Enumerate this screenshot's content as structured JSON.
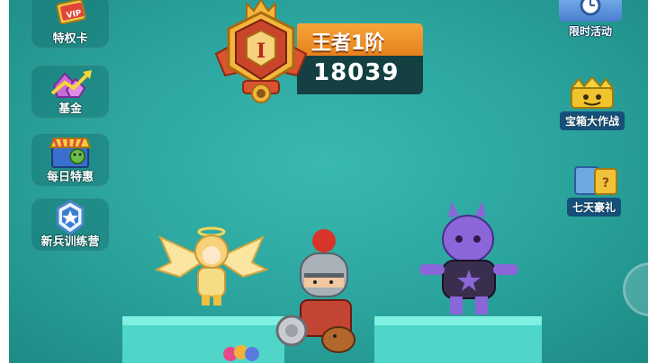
{
  "left_menu": [
    {
      "label": "特权卡",
      "icon": "vip-card-icon"
    },
    {
      "label": "基金",
      "icon": "fund-gem-icon"
    },
    {
      "label": "每日特惠",
      "icon": "daily-deal-shop-icon"
    },
    {
      "label": "新兵训练营",
      "icon": "recruit-badge-icon"
    }
  ],
  "right_menu": [
    {
      "label": "限时活动",
      "icon": "timer-clock-icon"
    },
    {
      "label": "宝箱大作战",
      "icon": "treasure-chest-icon"
    },
    {
      "label": "七天豪礼",
      "icon": "seven-day-gift-icon"
    }
  ],
  "rank": {
    "tier_letter": "I",
    "title": "王者1阶",
    "score": "18039"
  },
  "colors": {
    "background": "#2aa39c",
    "rank_orange": "#f08f28",
    "rank_dark": "#0f282d",
    "badge_red": "#c8452a",
    "badge_gold": "#f3b63b"
  }
}
